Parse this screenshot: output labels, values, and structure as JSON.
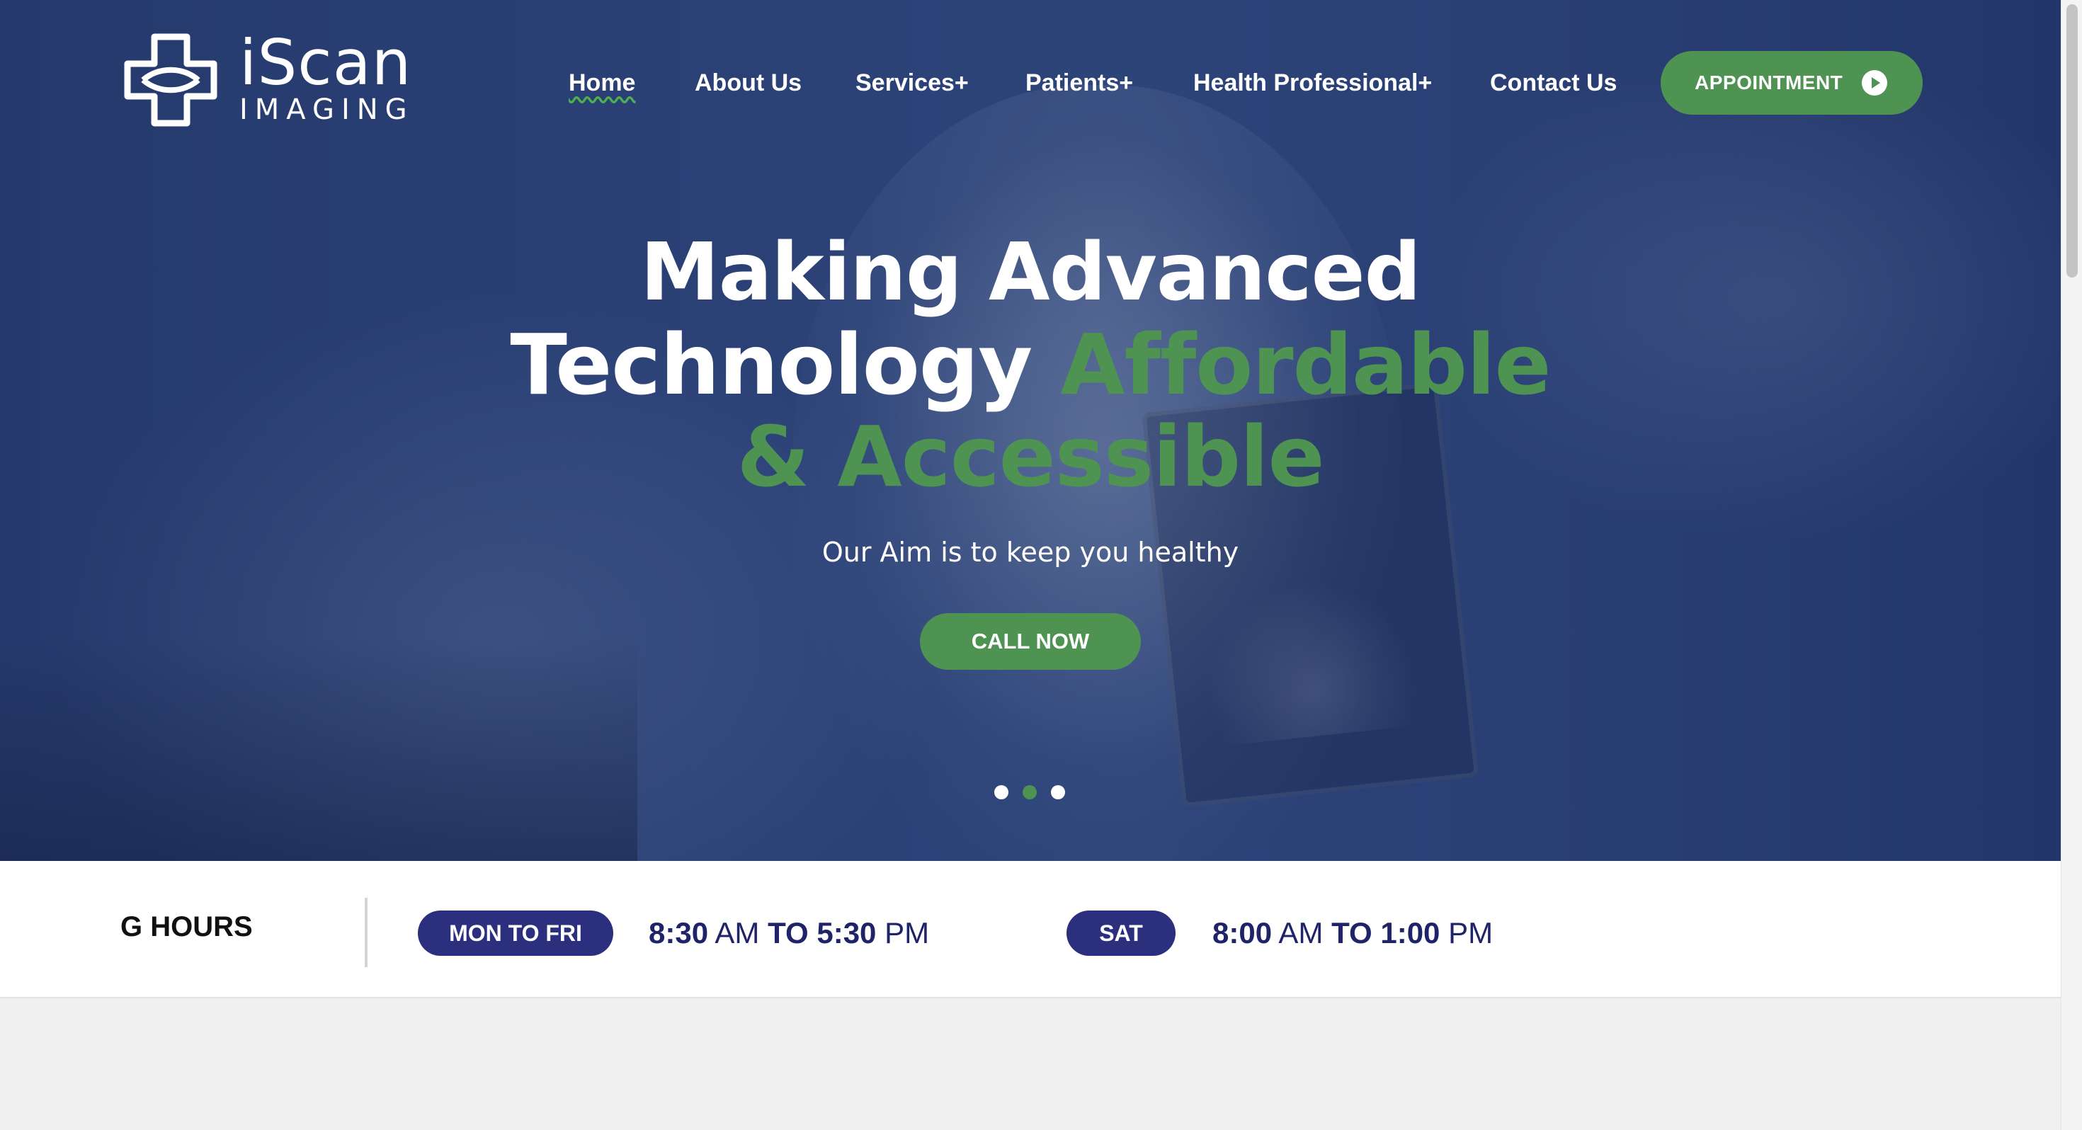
{
  "brand": {
    "name": "iScan",
    "sub": "IMAGING",
    "logo_icon": "medical-cross-icon"
  },
  "nav": {
    "items": [
      {
        "label": "Home",
        "active": true
      },
      {
        "label": "About Us"
      },
      {
        "label": "Services+"
      },
      {
        "label": "Patients+"
      },
      {
        "label": "Health Professional+"
      },
      {
        "label": "Contact Us"
      }
    ],
    "appointment_label": "APPOINTMENT",
    "appointment_icon": "play-circle-icon"
  },
  "hero": {
    "line1": "Making Advanced",
    "line2_white": "Technology",
    "line2_green": "Affordable",
    "line3_green": "& Accessible",
    "tagline": "Our Aim is to keep you healthy",
    "cta_label": "CALL NOW",
    "slides_count": 3,
    "active_slide": 2
  },
  "hours": {
    "title": "G HOURS",
    "weekday": {
      "label": "MON TO FRI",
      "open_time": "8:30",
      "open_period": "AM",
      "sep": "TO",
      "close_time": "5:30",
      "close_period": "PM"
    },
    "saturday": {
      "label": "SAT",
      "open_time": "8:00",
      "open_period": "AM",
      "sep": "TO",
      "close_time": "1:00",
      "close_period": "PM"
    }
  },
  "colors": {
    "hero_overlay": "#22376a",
    "accent_green": "#4f9353",
    "pill_navy": "#2b2f7e",
    "time_navy": "#1f2468"
  }
}
